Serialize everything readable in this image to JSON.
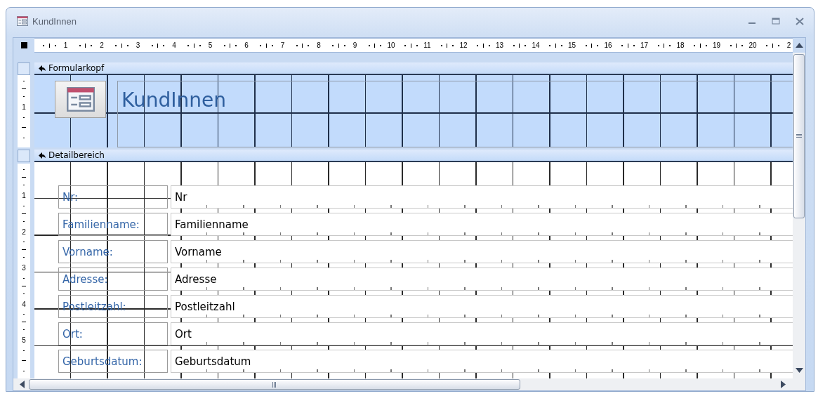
{
  "window": {
    "title": "KundInnen"
  },
  "top_ruler": [
    "1",
    "2",
    "3",
    "4",
    "5",
    "6",
    "7",
    "8",
    "9",
    "10",
    "11",
    "12",
    "13",
    "14",
    "15",
    "16",
    "17",
    "18",
    "19",
    "20",
    "2"
  ],
  "form_header": {
    "title": "Formularkopf",
    "ruler": [
      "1"
    ],
    "label": "KundInnen"
  },
  "detail": {
    "title": "Detailbereich",
    "ruler": [
      "1",
      "2",
      "3",
      "4",
      "5"
    ],
    "fields": [
      {
        "label": "Nr:",
        "value": "Nr"
      },
      {
        "label": "Familienname:",
        "value": "Familienname"
      },
      {
        "label": "Vorname:",
        "value": "Vorname"
      },
      {
        "label": "Adresse:",
        "value": "Adresse"
      },
      {
        "label": "Postleitzahl:",
        "value": "Postleitzahl"
      },
      {
        "label": "Ort:",
        "value": "Ort"
      },
      {
        "label": "Geburtsdatum:",
        "value": "Geburtsdatum"
      }
    ]
  }
}
